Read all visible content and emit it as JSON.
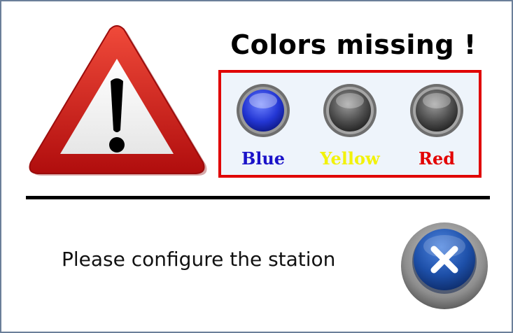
{
  "dialog": {
    "title": "Colors missing !",
    "message": "Please configure the station"
  },
  "colors": [
    {
      "label": "Blue",
      "label_color": "#1a12c9",
      "state": "present",
      "lamp_color": "#2d3fd6"
    },
    {
      "label": "Yellow",
      "label_color": "#f2f20a",
      "state": "missing",
      "lamp_color": "#555555"
    },
    {
      "label": "Red",
      "label_color": "#e30000",
      "state": "missing",
      "lamp_color": "#555555"
    }
  ],
  "icons": {
    "warning": "warning-triangle-icon",
    "close": "close-x-icon"
  },
  "theme": {
    "box_border": "#e00000",
    "box_background": "#eef4fb",
    "close_button_blue": "#1d4fa8"
  }
}
